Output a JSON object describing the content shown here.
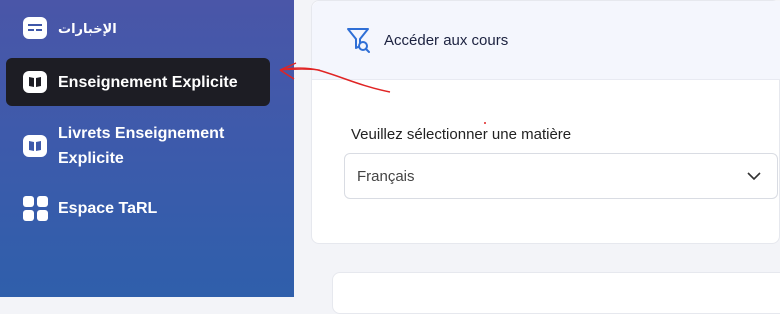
{
  "sidebar": {
    "items": [
      {
        "label": "الإخبارات",
        "icon": "news-icon"
      },
      {
        "label": "Enseignement Explicite",
        "icon": "book-icon",
        "active": true
      },
      {
        "label": "Livrets Enseignement Explicite",
        "icon": "book-icon"
      },
      {
        "label": "Espace TaRL",
        "icon": "grid-icon"
      }
    ]
  },
  "card": {
    "title": "Accéder aux cours",
    "icon": "filter-search-icon"
  },
  "form": {
    "subject_label": "Veuillez sélectionner une matière",
    "subject_value": "Français"
  },
  "colors": {
    "sidebar_top": "#4a56a8",
    "sidebar_bottom": "#2f5fab",
    "active_item": "#1d1d24",
    "accent": "#2f6fd6",
    "annotation_red": "#e02424"
  }
}
